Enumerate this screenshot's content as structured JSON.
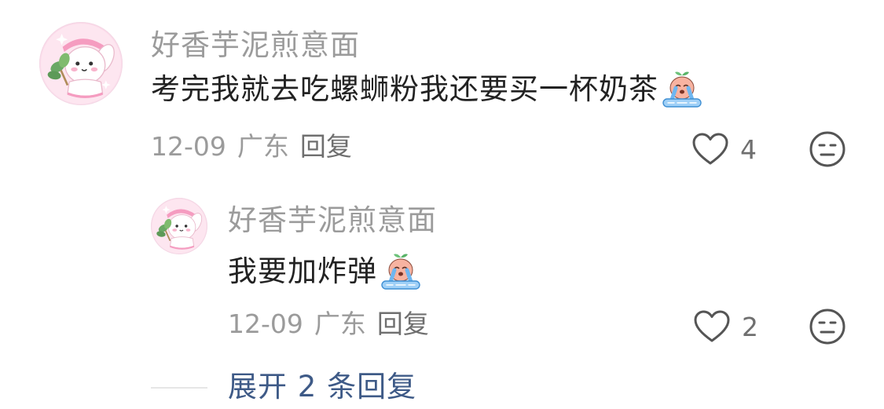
{
  "comment": {
    "username": "好香芋泥煎意面",
    "text": "考完我就去吃螺蛳粉我还要买一杯奶茶",
    "emoji": "crying-face-emoji",
    "date": "12-09",
    "location": "广东",
    "reply_label": "回复",
    "like_count": "4"
  },
  "reply": {
    "username": "好香芋泥煎意面",
    "text": "我要加炸弹",
    "emoji": "crying-face-emoji",
    "date": "12-09",
    "location": "广东",
    "reply_label": "回复",
    "like_count": "2"
  },
  "expand": {
    "label": "展开 2 条回复"
  },
  "icons": {
    "like": "heart-outline-icon",
    "dislike": "neutral-face-icon"
  },
  "colors": {
    "username": "#9b9b9b",
    "content": "#222222",
    "meta": "#9b9b9b",
    "action": "#6f6f6f",
    "expand_link": "#3e5a87",
    "avatar_bg": "#fde3ef"
  }
}
